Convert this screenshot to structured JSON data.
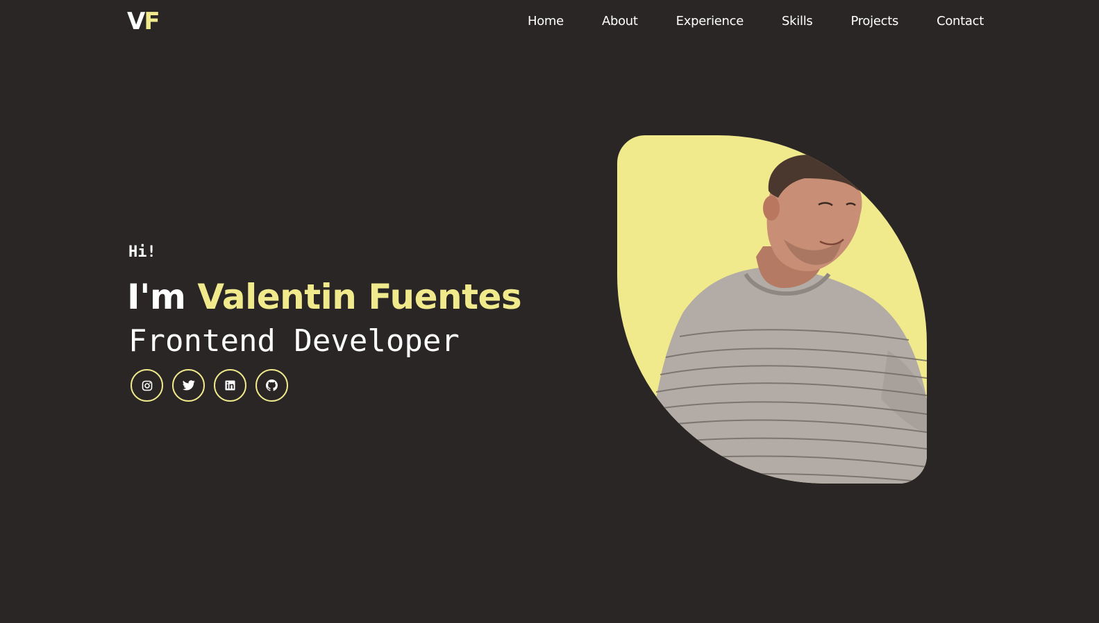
{
  "brand": {
    "logo_first": "V",
    "logo_second": "F"
  },
  "nav": {
    "items": [
      {
        "label": "Home"
      },
      {
        "label": "About"
      },
      {
        "label": "Experience"
      },
      {
        "label": "Skills"
      },
      {
        "label": "Projects"
      },
      {
        "label": "Contact"
      }
    ]
  },
  "hero": {
    "greeting": "Hi!",
    "intro": "I'm ",
    "name": "Valentin Fuentes",
    "role": "Frontend Developer",
    "socials": [
      {
        "icon": "instagram-icon"
      },
      {
        "icon": "twitter-icon"
      },
      {
        "icon": "linkedin-icon"
      },
      {
        "icon": "github-icon"
      }
    ]
  },
  "colors": {
    "background": "#2a2626",
    "accent": "#f0ea8c",
    "text": "#ffffff"
  }
}
